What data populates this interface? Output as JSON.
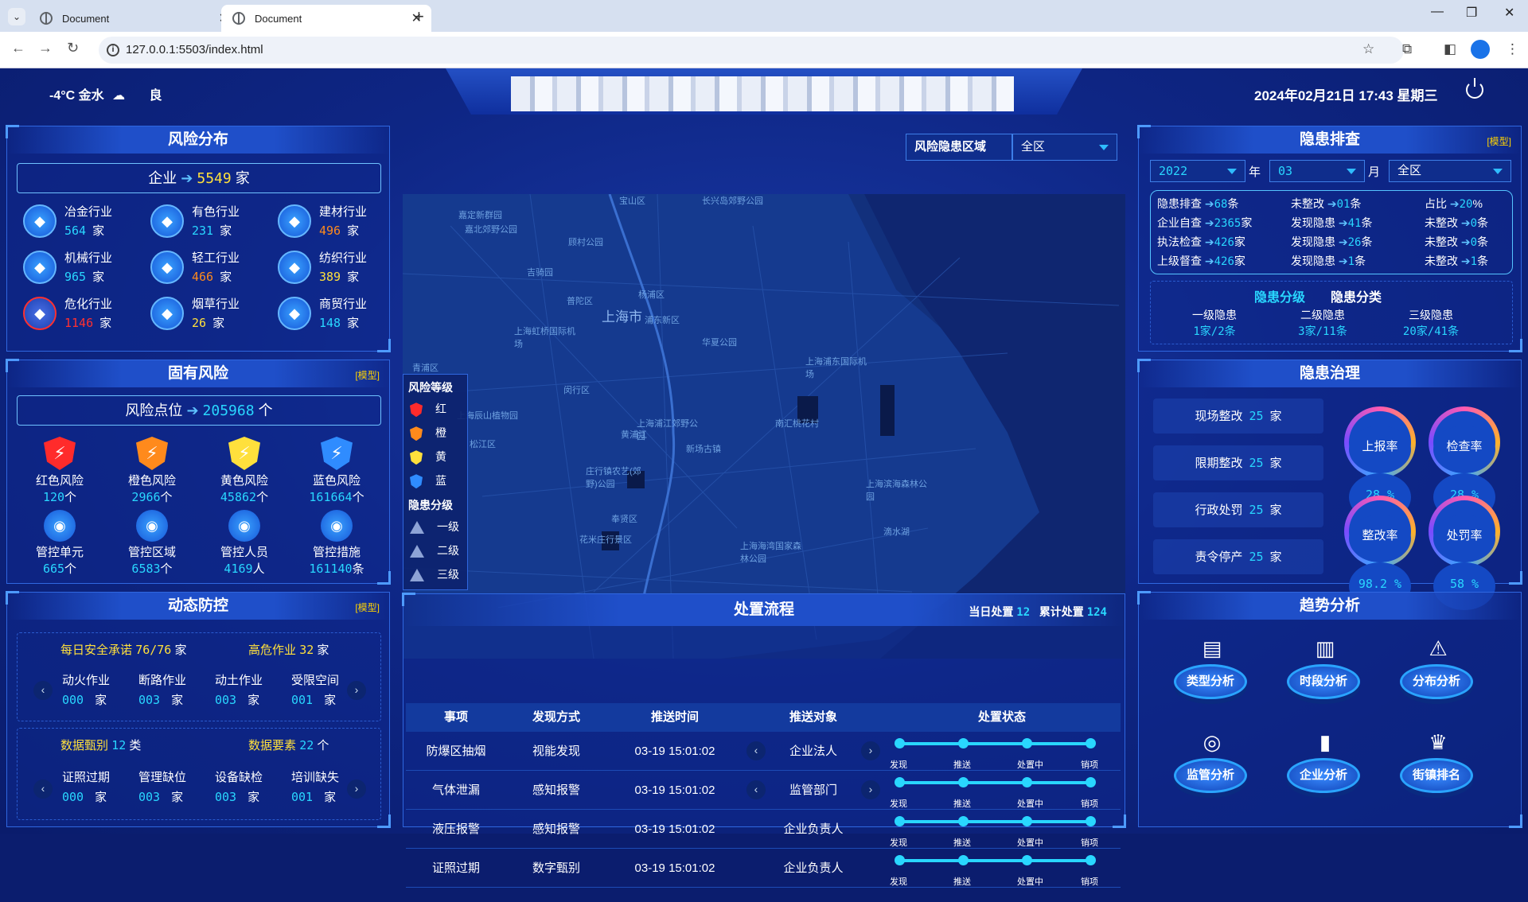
{
  "browser": {
    "tabs": [
      {
        "title": "Document"
      },
      {
        "title": "Document"
      }
    ],
    "url": "127.0.0.1:5503/index.html"
  },
  "header": {
    "weather": "-4°C 金水",
    "air": "良",
    "datetime": "2024年02月21日 17:43 星期三"
  },
  "risk_distribution": {
    "title": "风险分布",
    "company_label": "企业",
    "company_count": "5549",
    "company_unit": "家",
    "industries": [
      {
        "name": "冶金行业",
        "value": "564",
        "unit": "家",
        "icon": "building-icon",
        "color": "#29d7ff"
      },
      {
        "name": "有色行业",
        "value": "231",
        "unit": "家",
        "icon": "layers-icon",
        "color": "#29d7ff"
      },
      {
        "name": "建材行业",
        "value": "496",
        "unit": "家",
        "icon": "brick-icon",
        "color": "#ff8a1c"
      },
      {
        "name": "机械行业",
        "value": "965",
        "unit": "家",
        "icon": "gear-icon",
        "color": "#29d7ff"
      },
      {
        "name": "轻工行业",
        "value": "466",
        "unit": "家",
        "icon": "factory-icon",
        "color": "#ff8a1c"
      },
      {
        "name": "纺织行业",
        "value": "389",
        "unit": "家",
        "icon": "shirt-icon",
        "color": "#ffe03c"
      },
      {
        "name": "危化行业",
        "value": "1146",
        "unit": "家",
        "icon": "flask-icon",
        "color": "#ff3030"
      },
      {
        "name": "烟草行业",
        "value": "26",
        "unit": "家",
        "icon": "leaf-icon",
        "color": "#ffe03c"
      },
      {
        "name": "商贸行业",
        "value": "148",
        "unit": "家",
        "icon": "shop-icon",
        "color": "#29d7ff"
      }
    ]
  },
  "inherent_risk": {
    "title": "固有风险",
    "model": "[模型]",
    "point_label": "风险点位",
    "point_count": "205968",
    "point_unit": "个",
    "levels": [
      {
        "name": "红色风险",
        "value": "120",
        "unit": "个",
        "color": "#ff2b2b"
      },
      {
        "name": "橙色风险",
        "value": "2966",
        "unit": "个",
        "color": "#ff8a1c"
      },
      {
        "name": "黄色风险",
        "value": "45862",
        "unit": "个",
        "color": "#ffe03c"
      },
      {
        "name": "蓝色风险",
        "value": "161664",
        "unit": "个",
        "color": "#2f8cff"
      }
    ],
    "controls": [
      {
        "name": "管控单元",
        "value": "665",
        "unit": "个"
      },
      {
        "name": "管控区域",
        "value": "6583",
        "unit": "个"
      },
      {
        "name": "管控人员",
        "value": "4169",
        "unit": "人"
      },
      {
        "name": "管控措施",
        "value": "161140",
        "unit": "条"
      }
    ]
  },
  "dynamic": {
    "title": "动态防控",
    "model": "[模型]",
    "daily_label": "每日安全承诺",
    "daily_value": "76/76",
    "daily_unit": "家",
    "high_label": "高危作业",
    "high_value": "32",
    "high_unit": "家",
    "ops": [
      {
        "name": "动火作业",
        "value": "000",
        "unit": "家"
      },
      {
        "name": "断路作业",
        "value": "003",
        "unit": "家"
      },
      {
        "name": "动土作业",
        "value": "003",
        "unit": "家"
      },
      {
        "name": "受限空间",
        "value": "001",
        "unit": "家"
      }
    ],
    "screen_label": "数据甄别",
    "screen_value": "12",
    "screen_unit": "类",
    "elem_label": "数据要素",
    "elem_value": "22",
    "elem_unit": "个",
    "faults": [
      {
        "name": "证照过期",
        "value": "000",
        "unit": "家"
      },
      {
        "name": "管理缺位",
        "value": "003",
        "unit": "家"
      },
      {
        "name": "设备缺检",
        "value": "003",
        "unit": "家"
      },
      {
        "name": "培训缺失",
        "value": "001",
        "unit": "家"
      }
    ]
  },
  "map": {
    "region_label": "风险隐患区域",
    "region_value": "全区",
    "labels": [
      {
        "t": "上海市",
        "big": true
      },
      {
        "t": "嘉定新群园"
      },
      {
        "t": "嘉北郊野公园"
      },
      {
        "t": "顾村公园"
      },
      {
        "t": "吉骑园"
      },
      {
        "t": "长兴岛郊野公园"
      },
      {
        "t": "宝山区"
      },
      {
        "t": "杨浦区"
      },
      {
        "t": "浦东新区"
      },
      {
        "t": "普陀区"
      },
      {
        "t": "上海虹桥国际机场"
      },
      {
        "t": "青浦区"
      },
      {
        "t": "闵行区"
      },
      {
        "t": "华夏公园"
      },
      {
        "t": "上海浦东国际机场"
      },
      {
        "t": "上海辰山植物园"
      },
      {
        "t": "上海浦江郊野公园"
      },
      {
        "t": "南汇桃花村"
      },
      {
        "t": "松江区"
      },
      {
        "t": "黄浦江"
      },
      {
        "t": "新场古镇"
      },
      {
        "t": "庄行镇农艺(郊野)公园"
      },
      {
        "t": "上海滨海森林公园"
      },
      {
        "t": "奉贤区"
      },
      {
        "t": "花米庄行景区"
      },
      {
        "t": "上海海湾国家森林公园"
      },
      {
        "t": "滴水湖"
      }
    ],
    "legend": {
      "level_title": "风险等级",
      "levels": [
        {
          "t": "红",
          "c": "#ff2b2b"
        },
        {
          "t": "橙",
          "c": "#ff8a1c"
        },
        {
          "t": "黄",
          "c": "#ffe03c"
        },
        {
          "t": "蓝",
          "c": "#2f8cff"
        }
      ],
      "hazard_title": "隐患分级",
      "hazards": [
        {
          "t": "一级"
        },
        {
          "t": "二级"
        },
        {
          "t": "三级"
        }
      ]
    }
  },
  "process": {
    "title": "处置流程",
    "today_label": "当日处置",
    "today_value": "12",
    "total_label": "累计处置",
    "total_value": "124",
    "headers": [
      "事项",
      "发现方式",
      "推送时间",
      "推送对象",
      "处置状态"
    ],
    "steps": [
      "发现",
      "推送",
      "处置中",
      "销项"
    ],
    "rows": [
      {
        "item": "防爆区抽烟",
        "way": "视能发现",
        "time": "03-19 15:01:02",
        "target": "企业法人",
        "arrows": true
      },
      {
        "item": "气体泄漏",
        "way": "感知报警",
        "time": "03-19 15:01:02",
        "target": "监管部门",
        "arrows": true
      },
      {
        "item": "液压报警",
        "way": "感知报警",
        "time": "03-19 15:01:02",
        "target": "企业负责人",
        "arrows": false
      },
      {
        "item": "证照过期",
        "way": "数字甄别",
        "time": "03-19 15:01:02",
        "target": "企业负责人",
        "arrows": false
      }
    ]
  },
  "hazard_check": {
    "title": "隐患排查",
    "model": "[模型]",
    "year": "2022",
    "year_label": "年",
    "month": "03",
    "month_label": "月",
    "area": "全区",
    "col1": [
      {
        "name": "隐患排查",
        "value": "68",
        "unit": "条"
      },
      {
        "name": "企业自查",
        "value": "2365",
        "unit": "家"
      },
      {
        "name": "执法检查",
        "value": "426",
        "unit": "家"
      },
      {
        "name": "上级督查",
        "value": "426",
        "unit": "家"
      }
    ],
    "col2": [
      {
        "name": "未整改",
        "value": "01",
        "unit": "条"
      },
      {
        "name": "发现隐患",
        "value": "41",
        "unit": "条"
      },
      {
        "name": "发现隐患",
        "value": "26",
        "unit": "条"
      },
      {
        "name": "发现隐患",
        "value": "1",
        "unit": "条"
      }
    ],
    "col3": [
      {
        "name": "占比",
        "value": "20",
        "unit": "%"
      },
      {
        "name": "未整改",
        "value": "0",
        "unit": "条"
      },
      {
        "name": "未整改",
        "value": "0",
        "unit": "条"
      },
      {
        "name": "未整改",
        "value": "1",
        "unit": "条"
      }
    ],
    "tab_a": "隐患分级",
    "tab_b": "隐患分类",
    "grades": [
      {
        "name": "一级隐患",
        "value": "1家/2条"
      },
      {
        "name": "二级隐患",
        "value": "3家/11条"
      },
      {
        "name": "三级隐患",
        "value": "20家/41条"
      }
    ]
  },
  "governance": {
    "title": "隐患治理",
    "items": [
      {
        "name": "现场整改",
        "value": "25",
        "unit": "家"
      },
      {
        "name": "限期整改",
        "value": "25",
        "unit": "家"
      },
      {
        "name": "行政处罚",
        "value": "25",
        "unit": "家"
      },
      {
        "name": "责令停产",
        "value": "25",
        "unit": "家"
      }
    ],
    "rates": [
      {
        "name": "上报率",
        "value": "28 %"
      },
      {
        "name": "检查率",
        "value": "28 %"
      },
      {
        "name": "整改率",
        "value": "98.2 %"
      },
      {
        "name": "处罚率",
        "value": "58 %"
      }
    ]
  },
  "trend": {
    "title": "趋势分析",
    "buttons": [
      {
        "label": "类型分析",
        "icon": "chart-monitor-icon",
        "glyph": "▤"
      },
      {
        "label": "时段分析",
        "icon": "building-chart-icon",
        "glyph": "▥"
      },
      {
        "label": "分布分析",
        "icon": "warning-icon",
        "glyph": "⚠"
      },
      {
        "label": "监管分析",
        "icon": "target-icon",
        "glyph": "◎"
      },
      {
        "label": "企业分析",
        "icon": "bars-icon",
        "glyph": "▮"
      },
      {
        "label": "街镇排名",
        "icon": "trophy-icon",
        "glyph": "♛"
      }
    ]
  }
}
